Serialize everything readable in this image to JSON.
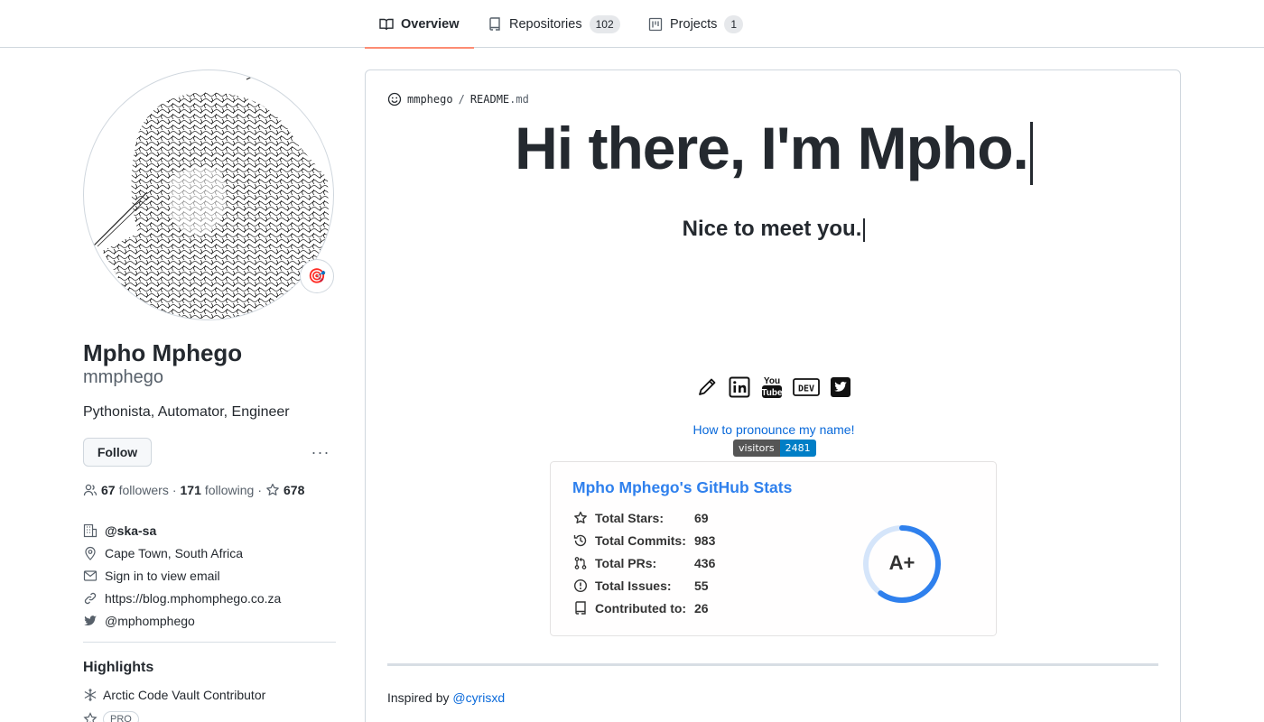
{
  "tabs": [
    {
      "label": "Overview",
      "icon": "book-icon",
      "active": true
    },
    {
      "label": "Repositories",
      "icon": "repo-icon",
      "count": "102"
    },
    {
      "label": "Projects",
      "icon": "project-icon",
      "count": "1"
    }
  ],
  "profile": {
    "full_name": "Mpho Mphego",
    "username": "mmphego",
    "bio": "Pythonista, Automator, Engineer",
    "follow_label": "Follow",
    "more_label": "···",
    "status_emoji": "🎯",
    "followers_count": "67",
    "followers_label": "followers",
    "following_count": "171",
    "following_label": "following",
    "stars_count": "678",
    "separator": "·",
    "details": {
      "org": "@ska-sa",
      "location": "Cape Town, South Africa",
      "email": "Sign in to view email",
      "website": "https://blog.mphomphego.co.za",
      "twitter": "@mphomphego"
    }
  },
  "highlights": {
    "title": "Highlights",
    "items": [
      {
        "label": "Arctic Code Vault Contributor",
        "icon": "snowflake-icon"
      },
      {
        "label": "PRO",
        "icon": "star-icon"
      }
    ]
  },
  "readme": {
    "owner": "mmphego",
    "separator": "/",
    "file_name": "README",
    "file_ext": ".md",
    "heading": "Hi there, I'm Mpho.",
    "subheading": "Nice to meet you.",
    "social_icons": [
      "pencil-icon",
      "linkedin-icon",
      "youtube-icon",
      "dev-icon",
      "twitter-icon"
    ],
    "youtube_text": "You\nTube",
    "dev_text": "DEV",
    "pronounce_link": "How to pronounce my name!",
    "visitors_label": "visitors",
    "visitors_count": "2481",
    "inspired_prefix": "Inspired by",
    "inspired_link": "@cyrisxd"
  },
  "stats_card": {
    "title": "Mpho Mphego's GitHub Stats",
    "rows": [
      {
        "label": "Total Stars:",
        "value": "69",
        "icon": "star-icon"
      },
      {
        "label": "Total Commits:",
        "value": "983",
        "icon": "history-icon"
      },
      {
        "label": "Total PRs:",
        "value": "436",
        "icon": "pull-request-icon"
      },
      {
        "label": "Total Issues:",
        "value": "55",
        "icon": "issue-icon"
      },
      {
        "label": "Contributed to:",
        "value": "26",
        "icon": "repo-icon"
      }
    ],
    "grade": "A+",
    "grade_fill": 0.6,
    "ring_color": "#2f80ed"
  },
  "colors": {
    "accent_link": "#0969da",
    "tab_underline": "#fd8c73",
    "stats_title": "#2f80ed"
  }
}
